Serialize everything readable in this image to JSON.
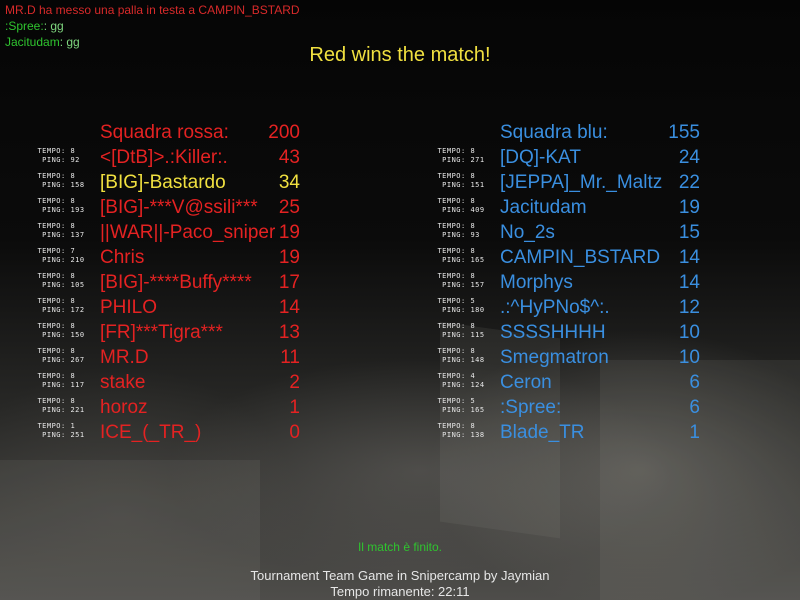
{
  "chat": [
    {
      "text": "MR.D ha messo una palla in testa a CAMPIN_BSTARD"
    },
    {
      "name": ":Spree:",
      "sep": ": ",
      "msg": "gg"
    },
    {
      "name": "Jacitudam",
      "sep": ": ",
      "msg": "gg"
    }
  ],
  "headline": "Red wins the match!",
  "stat_labels": {
    "time": "TEMPO:",
    "ping": "PING:"
  },
  "red_team": {
    "title": "Squadra rossa:",
    "score": "200",
    "players": [
      {
        "name": "<[DtB]>.:Killer:.",
        "score": "43",
        "time": "8",
        "ping": "92"
      },
      {
        "name": "[BIG]-Bastardo",
        "score": "34",
        "time": "8",
        "ping": "158",
        "highlight": true
      },
      {
        "name": "[BIG]-***V@ssili***",
        "score": "25",
        "time": "8",
        "ping": "193"
      },
      {
        "name": "||WAR||-Paco_sniper",
        "score": "19",
        "time": "8",
        "ping": "137"
      },
      {
        "name": "Chris",
        "score": "19",
        "time": "7",
        "ping": "210"
      },
      {
        "name": "[BIG]-****Buffy****",
        "score": "17",
        "time": "8",
        "ping": "105"
      },
      {
        "name": "PHILO",
        "score": "14",
        "time": "8",
        "ping": "172"
      },
      {
        "name": "[FR]***Tigra***",
        "score": "13",
        "time": "8",
        "ping": "150"
      },
      {
        "name": "MR.D",
        "score": "11",
        "time": "8",
        "ping": "267"
      },
      {
        "name": "stake",
        "score": "2",
        "time": "8",
        "ping": "117"
      },
      {
        "name": "horoz",
        "score": "1",
        "time": "8",
        "ping": "221"
      },
      {
        "name": "ICE_(_TR_)",
        "score": "0",
        "time": "1",
        "ping": "251"
      }
    ]
  },
  "blue_team": {
    "title": "Squadra blu:",
    "score": "155",
    "players": [
      {
        "name": "[DQ]-KAT",
        "score": "24",
        "time": "8",
        "ping": "271"
      },
      {
        "name": "[JEPPA]_Mr._Maltz",
        "score": "22",
        "time": "8",
        "ping": "151"
      },
      {
        "name": "Jacitudam",
        "score": "19",
        "time": "8",
        "ping": "409"
      },
      {
        "name": "No_2s",
        "score": "15",
        "time": "8",
        "ping": "93"
      },
      {
        "name": "CAMPIN_BSTARD",
        "score": "14",
        "time": "8",
        "ping": "165"
      },
      {
        "name": "Morphys",
        "score": "14",
        "time": "8",
        "ping": "157"
      },
      {
        "name": ".:^HyPNo$^:.",
        "score": "12",
        "time": "5",
        "ping": "180"
      },
      {
        "name": "SSSSHHHH",
        "score": "10",
        "time": "8",
        "ping": "115"
      },
      {
        "name": "Smegmatron",
        "score": "10",
        "time": "8",
        "ping": "148"
      },
      {
        "name": "Ceron",
        "score": "6",
        "time": "4",
        "ping": "124"
      },
      {
        "name": ":Spree:",
        "score": "6",
        "time": "5",
        "ping": "165"
      },
      {
        "name": "Blade_TR",
        "score": "1",
        "time": "8",
        "ping": "138"
      }
    ]
  },
  "status": "Il match è finito.",
  "footer": {
    "line1": "Tournament Team Game in Snipercamp by Jaymian",
    "line2": "Tempo rimanente:  22:11"
  },
  "colors": {
    "red": "#e42222",
    "blue": "#3a8fe0",
    "yellow": "#f0e040",
    "green": "#2fc42f"
  }
}
